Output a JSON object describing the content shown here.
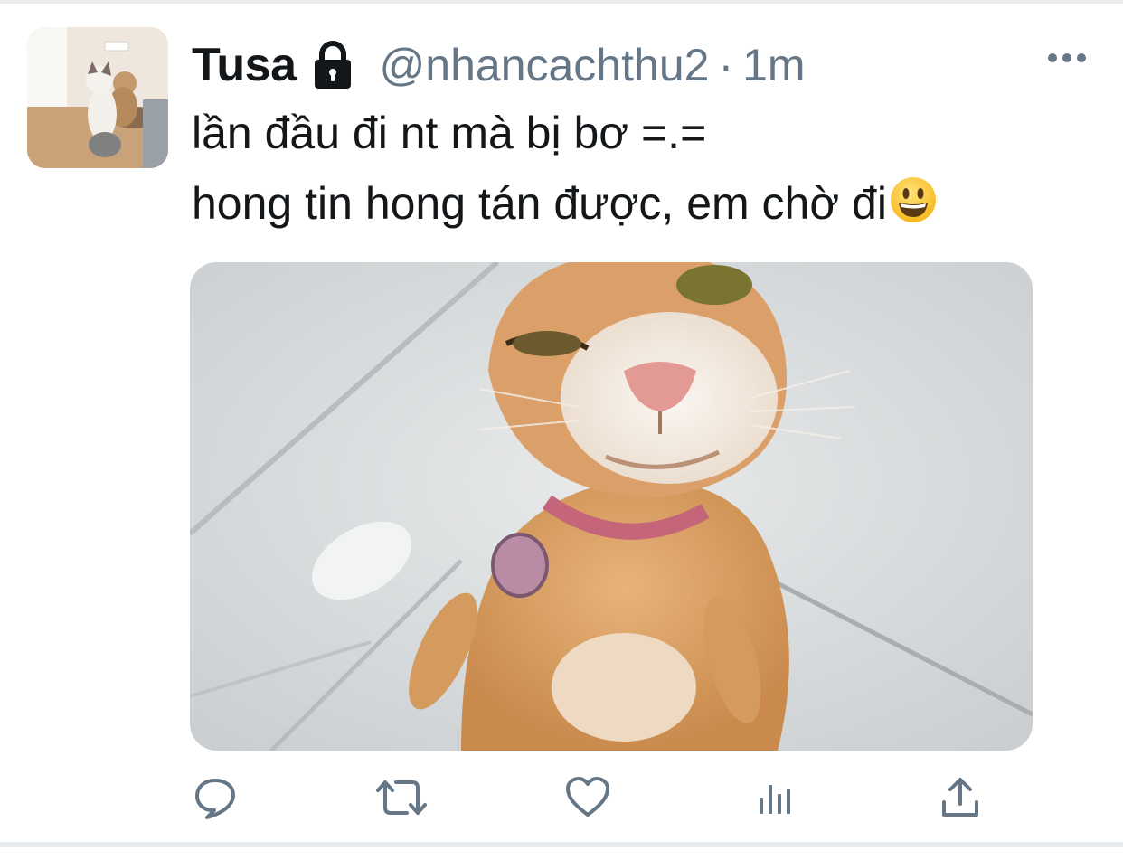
{
  "tweet": {
    "author": {
      "display_name": "Tusa",
      "handle": "@nhancachthu2",
      "protected_icon": "lock-icon",
      "avatar": "avatar-cat-photo"
    },
    "separator": "·",
    "time": "1m",
    "text_lines": [
      "lần đầu đi nt mà bị bơ =.=",
      "hong tin hong tán được, em chờ đi"
    ],
    "text_emoji": "grinning-face-emoji",
    "media": {
      "kind": "photo",
      "subject": "orange tabby cat wearing pink collar"
    }
  },
  "actions": [
    {
      "name": "reply",
      "icon": "reply-icon"
    },
    {
      "name": "retweet",
      "icon": "retweet-icon"
    },
    {
      "name": "like",
      "icon": "heart-icon"
    },
    {
      "name": "analytics",
      "icon": "analytics-icon"
    },
    {
      "name": "share",
      "icon": "share-icon"
    }
  ],
  "menu_icon": "more-icon",
  "colors": {
    "text_primary": "#14171a",
    "text_secondary": "#657786",
    "divider": "#e9ecef"
  }
}
